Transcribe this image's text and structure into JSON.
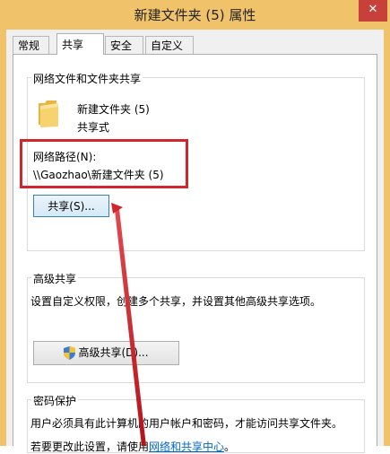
{
  "window": {
    "title": "新建文件夹 (5) 属性",
    "close_glyph": "✕"
  },
  "tabs": [
    {
      "label": "常规",
      "active": false
    },
    {
      "label": "共享",
      "active": true
    },
    {
      "label": "安全",
      "active": false
    },
    {
      "label": "自定义",
      "active": false
    }
  ],
  "network_share": {
    "legend": "网络文件和文件夹共享",
    "folder_name": "新建文件夹 (5)",
    "folder_status": "共享式",
    "path_label": "网络路径(N):",
    "path_value": "\\\\Gaozhao\\新建文件夹 (5)",
    "share_button": "共享(S)..."
  },
  "advanced_share": {
    "legend": "高级共享",
    "description": "设置自定义权限，创建多个共享，并设置其他高级共享选项。",
    "button": "高级共享(D)..."
  },
  "password": {
    "legend": "密码保护",
    "description": "用户必须具有此计算机的用户帐户和密码，才能访问共享文件夹。",
    "change_prefix": "若要更改此设置，请使用",
    "link": "网络和共享中心",
    "change_suffix": "。"
  },
  "colors": {
    "annotation": "#d0262d",
    "title_bar": "#f0c36a",
    "link": "#0066cc"
  }
}
